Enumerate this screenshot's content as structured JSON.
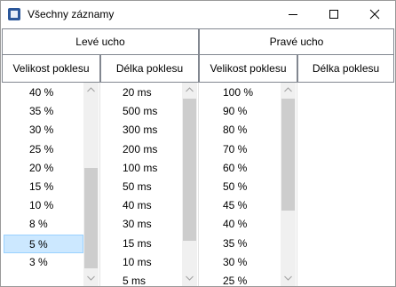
{
  "window": {
    "title": "Všechny záznamy"
  },
  "groups": {
    "left": "Levé ucho",
    "right": "Pravé ucho"
  },
  "columns": {
    "left_intensity": "Velikost poklesu",
    "left_duration": "Délka poklesu",
    "right_intensity": "Velikost poklesu",
    "right_duration": "Délka poklesu"
  },
  "lists": {
    "left_intensity": {
      "items": [
        "40 %",
        "35 %",
        "30 %",
        "25 %",
        "20 %",
        "15 %",
        "10 %",
        "8 %",
        "5 %",
        "3 %"
      ],
      "selected_index": 8
    },
    "left_duration": {
      "items": [
        "20 ms",
        "500 ms",
        "300 ms",
        "200 ms",
        "100 ms",
        "50 ms",
        "40 ms",
        "30 ms",
        "15 ms",
        "10 ms",
        "5 ms"
      ]
    },
    "right_intensity": {
      "items": [
        "100 %",
        "90 %",
        "80 %",
        "70 %",
        "60 %",
        "50 %",
        "45 %",
        "40 %",
        "35 %",
        "30 %",
        "25 %"
      ]
    },
    "right_duration": {
      "items": []
    }
  },
  "icons": {
    "app": "window-app-icon",
    "minimize": "minimize-icon",
    "maximize": "maximize-icon",
    "close": "close-icon",
    "scroll_up": "chevron-up-icon",
    "scroll_down": "chevron-down-icon"
  },
  "colors": {
    "selection_fill": "#cce8ff",
    "selection_border": "#99d1ff",
    "scrollbar_track": "#f0f0f0",
    "scrollbar_thumb": "#cdcdcd",
    "header_border": "#828790"
  }
}
